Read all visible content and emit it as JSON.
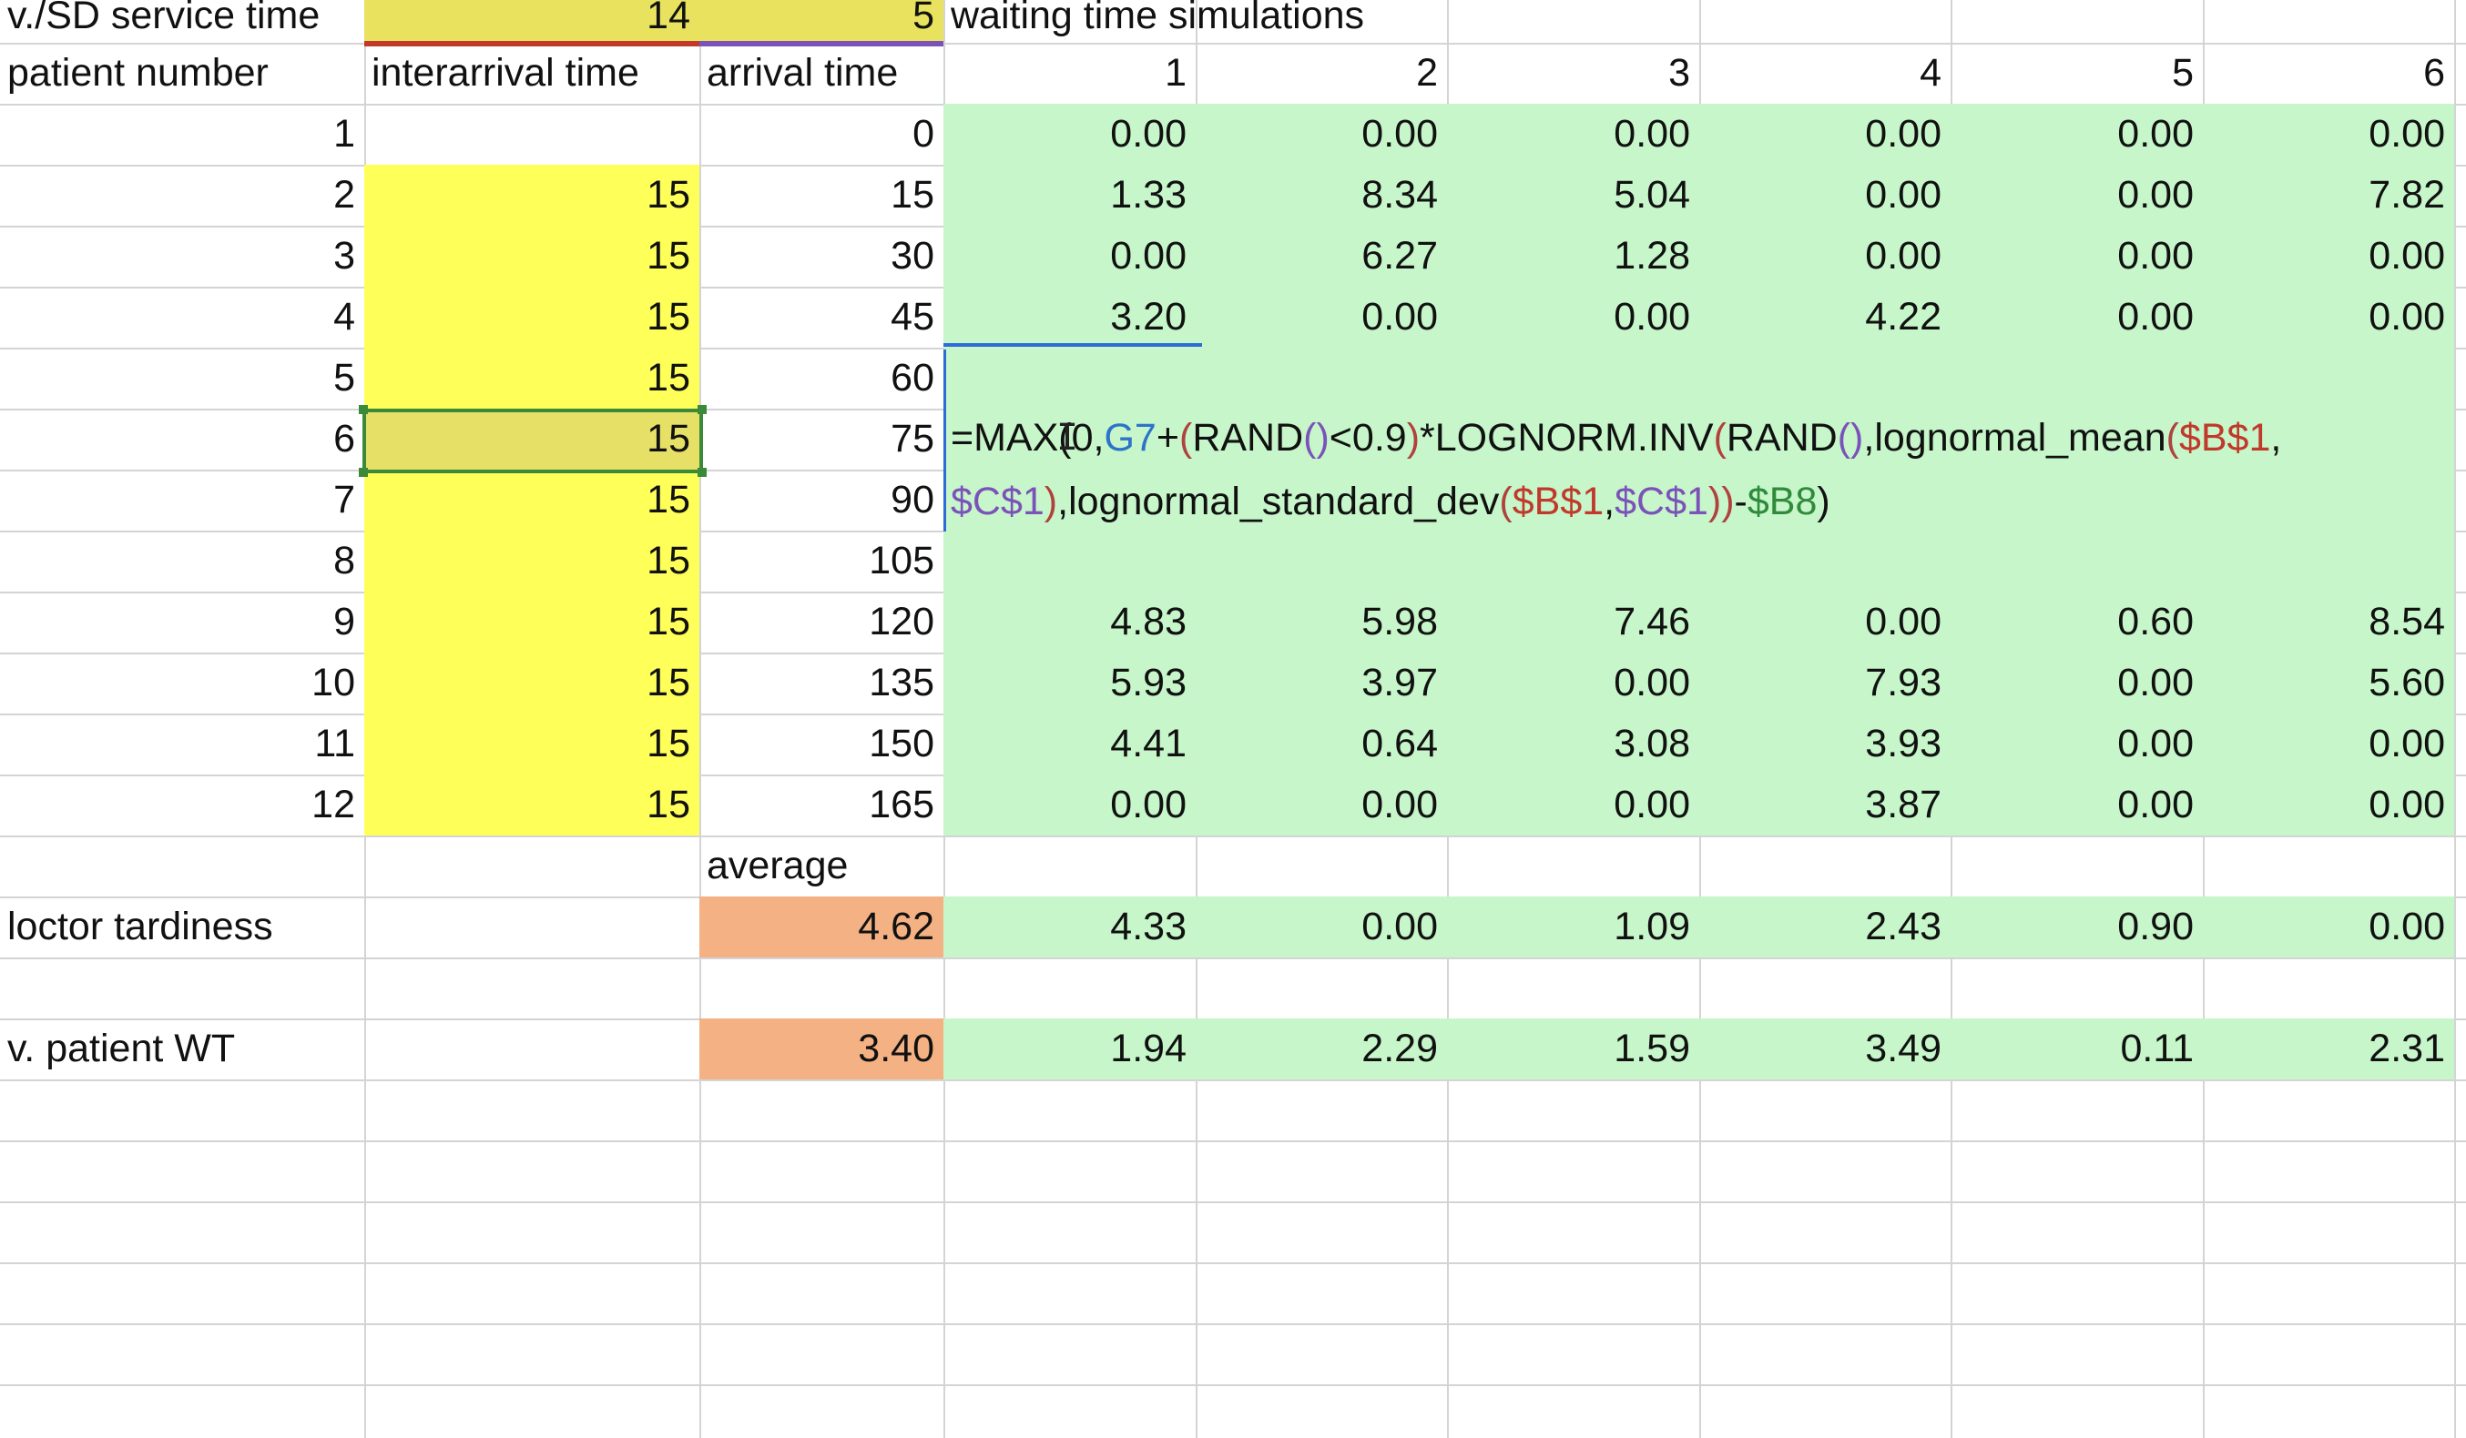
{
  "top_row": {
    "label": "v./SD service time",
    "value_b": "14",
    "value_c": "5",
    "label_sim": "waiting time simulations"
  },
  "header_row": {
    "col_a": "patient number",
    "col_b": "interarrival time",
    "col_c": "arrival time",
    "sim_cols": [
      "1",
      "2",
      "3",
      "4",
      "5",
      "6"
    ]
  },
  "rows": [
    {
      "patient": "1",
      "interarrival": "",
      "arrival": "0",
      "sims": [
        "0.00",
        "0.00",
        "0.00",
        "0.00",
        "0.00",
        "0.00"
      ]
    },
    {
      "patient": "2",
      "interarrival": "15",
      "arrival": "15",
      "sims": [
        "1.33",
        "8.34",
        "5.04",
        "0.00",
        "0.00",
        "7.82"
      ]
    },
    {
      "patient": "3",
      "interarrival": "15",
      "arrival": "30",
      "sims": [
        "0.00",
        "6.27",
        "1.28",
        "0.00",
        "0.00",
        "0.00"
      ]
    },
    {
      "patient": "4",
      "interarrival": "15",
      "arrival": "45",
      "sims": [
        "3.20",
        "0.00",
        "0.00",
        "4.22",
        "0.00",
        "0.00"
      ]
    },
    {
      "patient": "5",
      "interarrival": "15",
      "arrival": "60",
      "sims": [
        "",
        "",
        "",
        "",
        "",
        ""
      ]
    },
    {
      "patient": "6",
      "interarrival": "15",
      "arrival": "75",
      "sims": [
        "",
        "",
        "",
        "",
        "",
        ""
      ]
    },
    {
      "patient": "7",
      "interarrival": "15",
      "arrival": "90",
      "sims": [
        "",
        "",
        "",
        "",
        "",
        ""
      ]
    },
    {
      "patient": "8",
      "interarrival": "15",
      "arrival": "105",
      "sims": [
        "",
        "",
        "",
        "",
        "",
        ""
      ]
    },
    {
      "patient": "9",
      "interarrival": "15",
      "arrival": "120",
      "sims": [
        "4.83",
        "5.98",
        "7.46",
        "0.00",
        "0.60",
        "8.54"
      ]
    },
    {
      "patient": "10",
      "interarrival": "15",
      "arrival": "135",
      "sims": [
        "5.93",
        "3.97",
        "0.00",
        "7.93",
        "0.00",
        "5.60"
      ]
    },
    {
      "patient": "11",
      "interarrival": "15",
      "arrival": "150",
      "sims": [
        "4.41",
        "0.64",
        "3.08",
        "3.93",
        "0.00",
        "0.00"
      ]
    },
    {
      "patient": "12",
      "interarrival": "15",
      "arrival": "165",
      "sims": [
        "0.00",
        "0.00",
        "0.00",
        "3.87",
        "0.00",
        "0.00"
      ]
    }
  ],
  "average_label": "average",
  "doctor_row": {
    "label": "loctor tardiness",
    "average": "4.62",
    "sims": [
      "4.33",
      "0.00",
      "1.09",
      "2.43",
      "0.90",
      "0.00"
    ]
  },
  "patient_wt_row": {
    "label": "v. patient WT",
    "average": "3.40",
    "sims": [
      "1.94",
      "2.29",
      "1.59",
      "3.49",
      "0.11",
      "2.31"
    ]
  },
  "formula": {
    "line1": {
      "p1": "=MAX(0,",
      "p2": "G7",
      "p3": "+",
      "p4": "(",
      "p5": "RAND",
      "p6": "()",
      "p7": "<0.9",
      "p8": ")",
      "p9": "*LOGNORM.INV",
      "p10": "(",
      "p11": "RAND",
      "p12": "()",
      "p13": ",lognormal_mean",
      "p14": "(",
      "p15": "$B$1",
      "p16": ","
    },
    "line2": {
      "p1": "$C$1",
      "p2": ")",
      "p3": ",lognormal_standard_dev",
      "p4": "(",
      "p5": "$B$1",
      "p6": ",",
      "p7": "$C$1",
      "p8": "))",
      "p9": "-",
      "p10": "$B8",
      "p11": ")"
    }
  },
  "colors": {
    "green_fill": "#c6f6c9",
    "yellow_fill": "#ffff5a",
    "gold_fill": "#e9e25f",
    "orange_fill": "#f4b183",
    "grid": "#d4d4d4",
    "selection_green": "#3a8a3a",
    "edit_blue": "#2e6bd6"
  }
}
